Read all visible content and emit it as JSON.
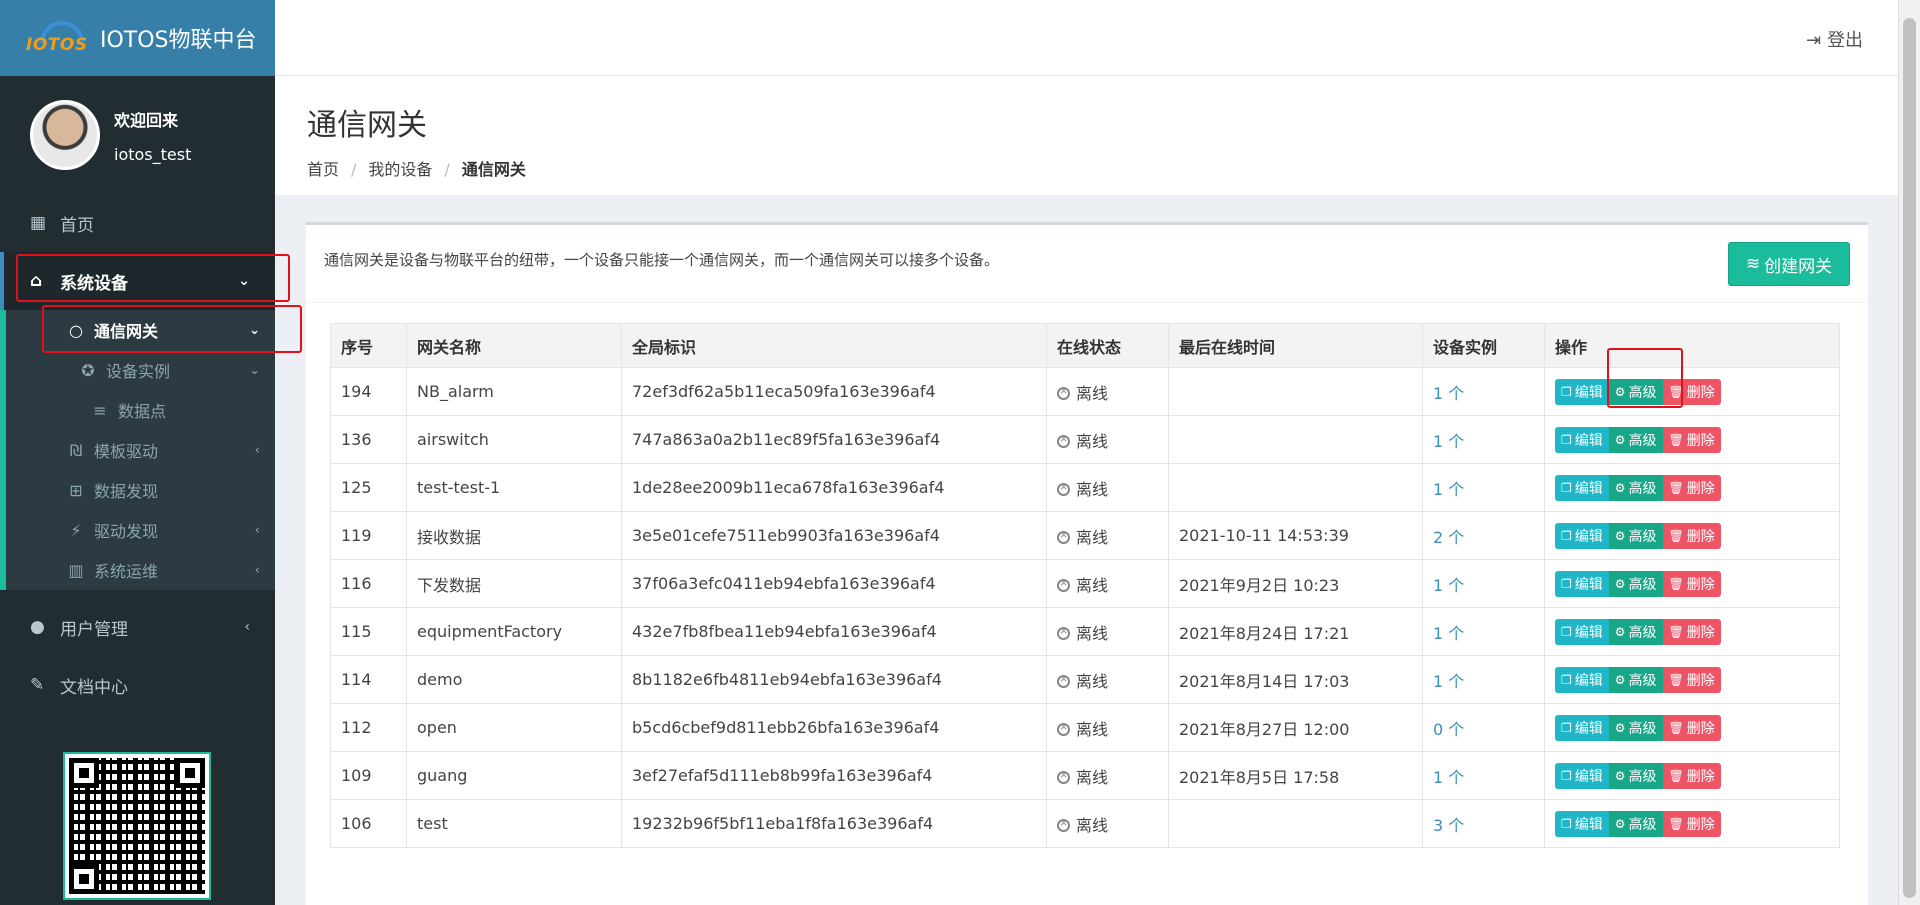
{
  "app": {
    "logo_text": "IOTOS",
    "title": "IOTOS物联中台"
  },
  "user": {
    "welcome": "欢迎回来",
    "username": "iotos_test"
  },
  "sidebar": {
    "home": "首页",
    "system_devices": "系统设备",
    "gateway": "通信网关",
    "device_instance": "设备实例",
    "datapoint": "数据点",
    "template_driver": "模板驱动",
    "data_discovery": "数据发现",
    "driver_discovery": "驱动发现",
    "system_ops": "系统运维",
    "user_mgmt": "用户管理",
    "docs": "文档中心"
  },
  "header": {
    "logout": "登出"
  },
  "page": {
    "title": "通信网关",
    "breadcrumb": [
      "首页",
      "我的设备",
      "通信网关"
    ],
    "description": "通信网关是设备与物联平台的纽带，一个设备只能接一个通信网关，而一个通信网关可以接多个设备。",
    "create_label": "创建网关"
  },
  "table": {
    "headers": [
      "序号",
      "网关名称",
      "全局标识",
      "在线状态",
      "最后在线时间",
      "设备实例",
      "操作"
    ],
    "actions": {
      "edit": "编辑",
      "advanced": "高级",
      "delete": "删除"
    },
    "rows": [
      [
        "194",
        "NB_alarm",
        "72ef3df62a5b11eca509fa163e396af4",
        "离线",
        "",
        "1 个"
      ],
      [
        "136",
        "airswitch",
        "747a863a0a2b11ec89f5fa163e396af4",
        "离线",
        "",
        "1 个"
      ],
      [
        "125",
        "test-test-1",
        "1de28ee2009b11eca678fa163e396af4",
        "离线",
        "",
        "1 个"
      ],
      [
        "119",
        "接收数据",
        "3e5e01cefe7511eb9903fa163e396af4",
        "离线",
        "2021-10-11 14:53:39",
        "2 个"
      ],
      [
        "116",
        "下发数据",
        "37f06a3efc0411eb94ebfa163e396af4",
        "离线",
        "2021年9月2日 10:23",
        "1 个"
      ],
      [
        "115",
        "equipmentFactory",
        "432e7fb8fbea11eb94ebfa163e396af4",
        "离线",
        "2021年8月24日 17:21",
        "1 个"
      ],
      [
        "114",
        "demo",
        "8b1182e6fb4811eb94ebfa163e396af4",
        "离线",
        "2021年8月14日 17:03",
        "1 个"
      ],
      [
        "112",
        "open",
        "b5cd6cbef9d811ebb26bfa163e396af4",
        "离线",
        "2021年8月27日 12:00",
        "0 个"
      ],
      [
        "109",
        "guang",
        "3ef27efaf5d111eb8b99fa163e396af4",
        "离线",
        "2021年8月5日 17:58",
        "1 个"
      ],
      [
        "106",
        "test",
        "19232b96f5bf11eba1f8fa163e396af4",
        "离线",
        "",
        "3 个"
      ]
    ]
  }
}
